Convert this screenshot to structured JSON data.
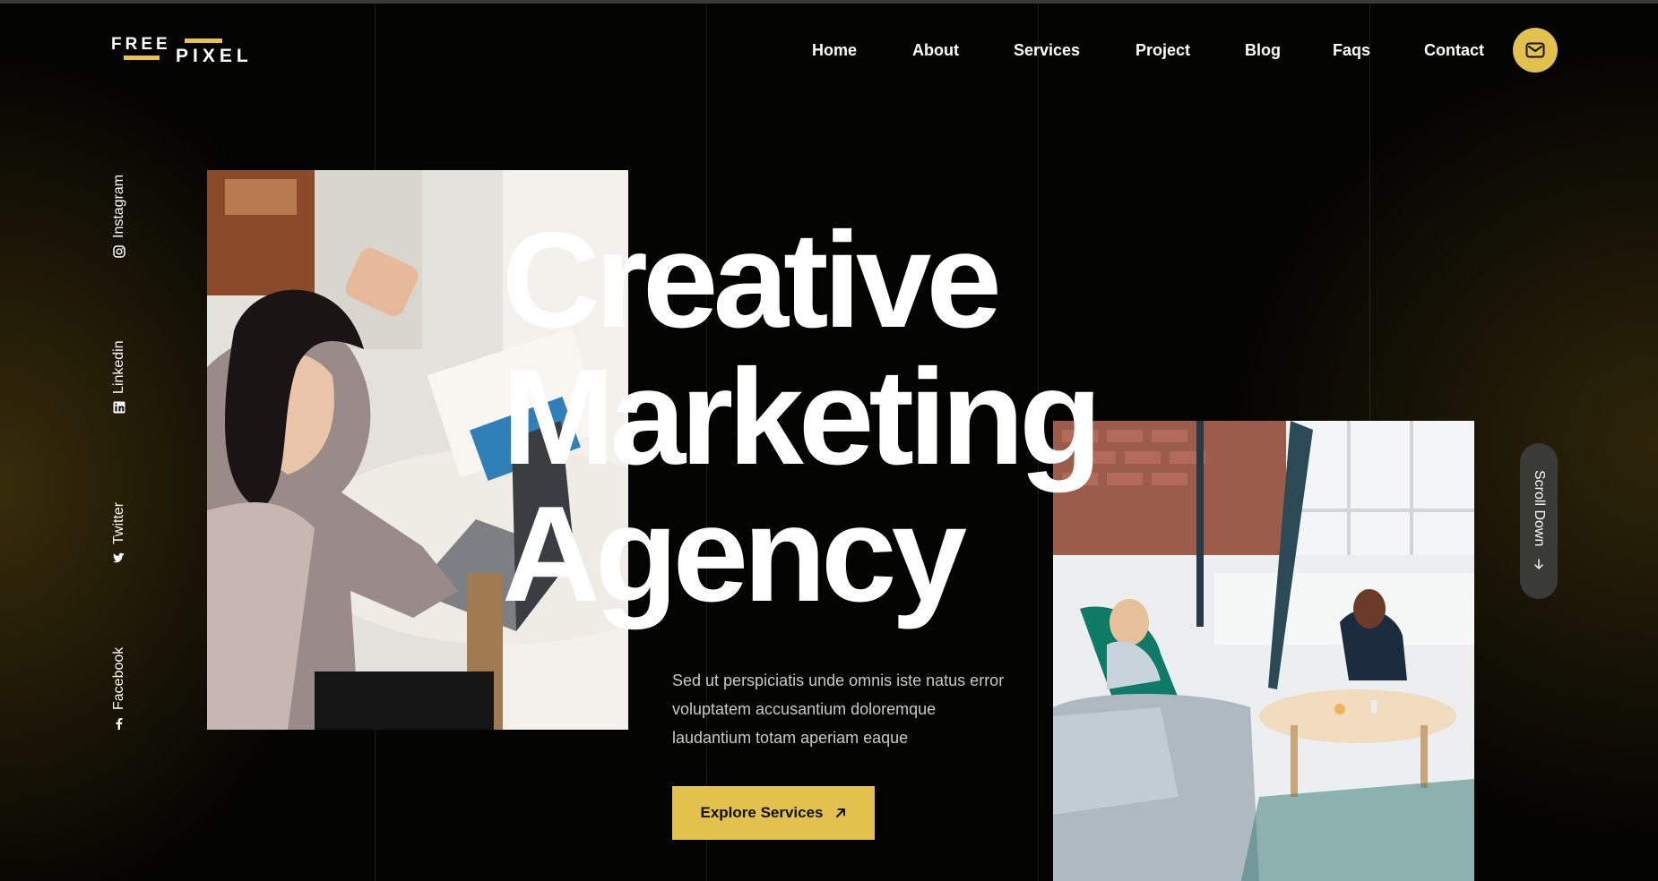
{
  "logo": {
    "top": "FREE",
    "bottom": "PIXEL"
  },
  "nav": {
    "items": [
      {
        "label": "Home"
      },
      {
        "label": "About"
      },
      {
        "label": "Services"
      },
      {
        "label": "Project"
      },
      {
        "label": "Blog"
      },
      {
        "label": "Faqs"
      },
      {
        "label": "Contact"
      }
    ],
    "mail_icon": "mail-icon"
  },
  "social": [
    {
      "label": "Instagram",
      "icon": "instagram-icon"
    },
    {
      "label": "Linkedin",
      "icon": "linkedin-icon"
    },
    {
      "label": "Twitter",
      "icon": "twitter-icon"
    },
    {
      "label": "Facebook",
      "icon": "facebook-icon"
    }
  ],
  "hero": {
    "line1": "Creative",
    "line2": "Marketing",
    "line3": "Agency",
    "description": "Sed ut perspiciatis unde omnis iste natus error voluptatem accusantium doloremque laudantium totam aperiam eaque",
    "cta_label": "Explore Services",
    "cta_icon": "arrow-up-right-icon"
  },
  "scroll": {
    "label": "Scroll Down",
    "icon": "arrow-down-icon"
  },
  "colors": {
    "accent": "#e2c24d",
    "background": "#030302",
    "text": "#ffffff"
  }
}
